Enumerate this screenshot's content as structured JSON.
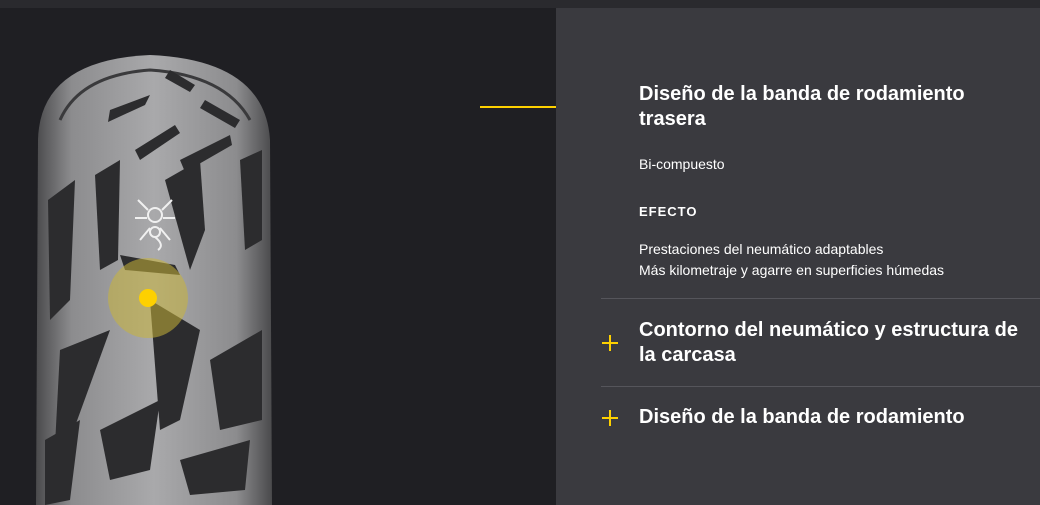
{
  "panel": {
    "active_item": {
      "title": "Diseño de la banda de rodamiento trasera",
      "compound": "Bi-compuesto",
      "effect_label": "EFECTO",
      "effect_lines": [
        "Prestaciones del neumático adaptables",
        "Más kilometraje y agarre en superficies húmedas"
      ]
    },
    "items": [
      {
        "title": "Contorno del neumático y estructura de la carcasa",
        "icon": "plus-icon"
      },
      {
        "title": "Diseño de la banda de rodamiento",
        "icon": "plus-icon"
      }
    ]
  },
  "colors": {
    "accent": "#fdd000",
    "panel_bg": "#3a3a3f",
    "page_bg": "#1f1f23"
  }
}
